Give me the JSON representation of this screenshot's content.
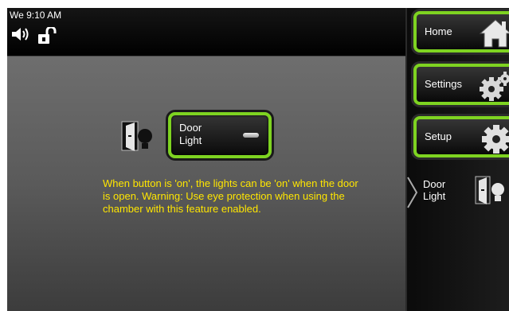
{
  "status_bar": {
    "time": "We 9:10 AM",
    "icons": [
      "speaker-icon",
      "unlocked-padlock-icon"
    ]
  },
  "main": {
    "control": {
      "icon": "door-light-icon",
      "label": "Door\nLight",
      "state_indicator": "off"
    },
    "help_text": "When button is 'on', the lights can be 'on' when the door is open.  Warning: Use eye protection when using the chamber with this feature enabled."
  },
  "sidebar": {
    "buttons": [
      {
        "label": "Home",
        "icon": "home-icon"
      },
      {
        "label": "Settings",
        "icon": "gears-icon"
      },
      {
        "label": "Setup",
        "icon": "gear-icon"
      }
    ],
    "current_page": {
      "label": "Door\nLight",
      "icon": "door-light-icon"
    }
  },
  "colors": {
    "accent_green": "#7ed321",
    "help_text_yellow": "#ffe600",
    "panel_gray": "#6e6e6e"
  }
}
